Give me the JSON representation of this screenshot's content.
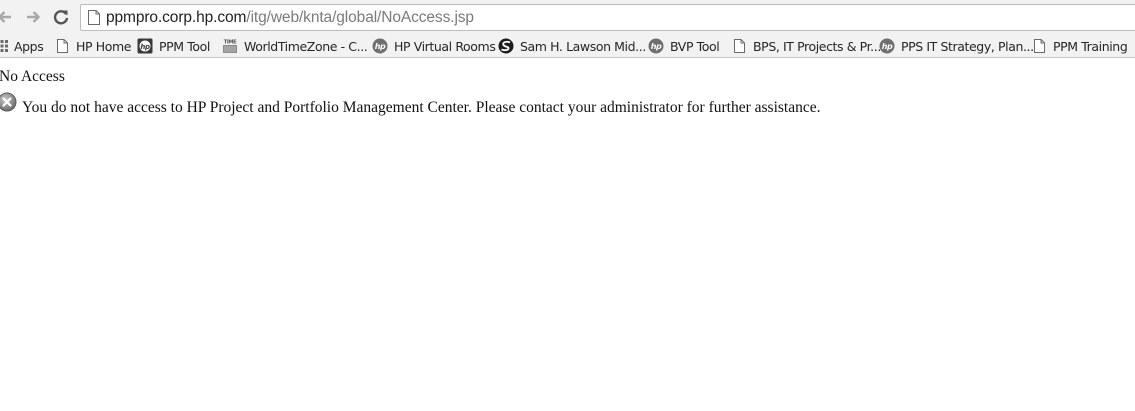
{
  "browser": {
    "url": {
      "host": "ppmpro.corp.hp.com",
      "path": "/itg/web/knta/global/NoAccess.jsp"
    }
  },
  "bookmarks": {
    "items": [
      {
        "label": "Apps",
        "icon": "apps-grid-icon"
      },
      {
        "label": "HP Home",
        "icon": "page-icon"
      },
      {
        "label": "PPM Tool",
        "icon": "hp-square-icon"
      },
      {
        "label": "WorldTimeZone - C...",
        "icon": "timezone-icon"
      },
      {
        "label": "HP Virtual Rooms",
        "icon": "hp-logo-icon"
      },
      {
        "label": "Sam H. Lawson Mid...",
        "icon": "school-logo-icon"
      },
      {
        "label": "BVP Tool",
        "icon": "hp-logo-icon"
      },
      {
        "label": "BPS, IT Projects & Pr...",
        "icon": "page-icon"
      },
      {
        "label": "PPS IT Strategy, Plan...",
        "icon": "hp-logo-icon"
      },
      {
        "label": "PPM Training",
        "icon": "page-icon"
      }
    ]
  },
  "page": {
    "title": "No Access",
    "message": "You do not have access to HP Project and Portfolio Management Center. Please contact your administrator for further assistance.",
    "icon": "error-x-circle-icon"
  }
}
